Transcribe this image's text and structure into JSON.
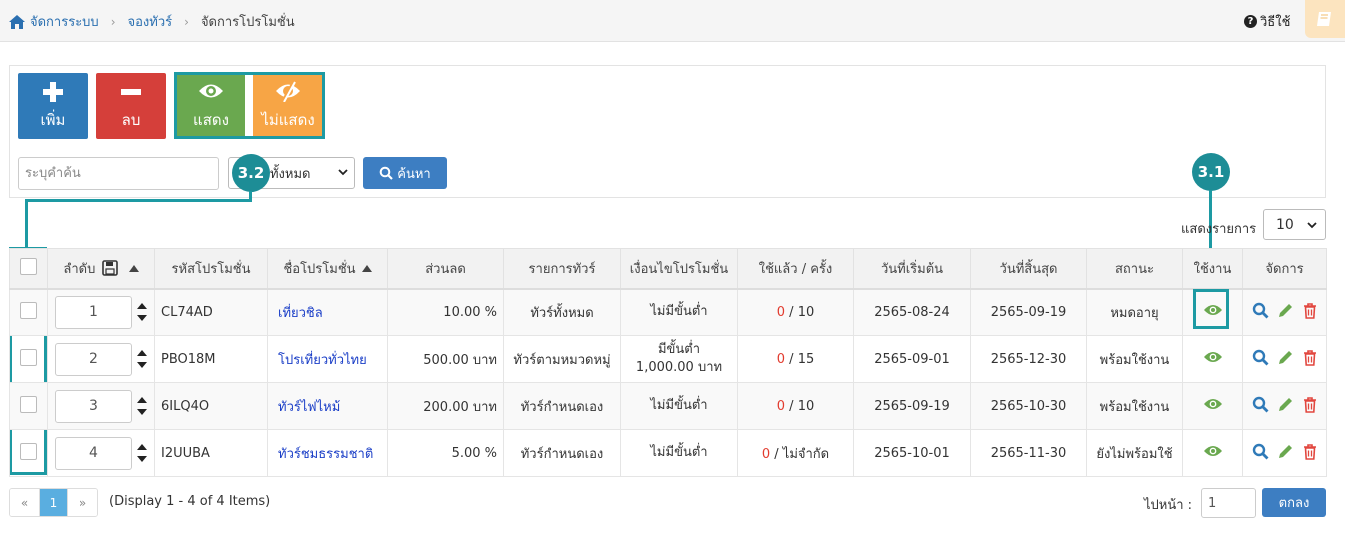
{
  "breadcrumb": {
    "home": "จัดการระบบ",
    "section": "จองทัวร์",
    "current": "จัดการโปรโมชั่น"
  },
  "help": {
    "label": "วิธีใช้"
  },
  "toolbar": {
    "add": "เพิ่ม",
    "delete": "ลบ",
    "show": "แสดง",
    "hide": "ไม่แสดง"
  },
  "search": {
    "placeholder": "ระบุคำค้น",
    "filter_value": "ะทั้งหมด",
    "button": "ค้นหา"
  },
  "callouts": {
    "a": "3.2",
    "b": "3.1"
  },
  "perpage": {
    "label": "แสดงรายการ",
    "value": "10"
  },
  "table": {
    "headers": [
      "ลำดับ",
      "รหัสโปรโมชั่น",
      "ชื่อโปรโมชั่น",
      "ส่วนลด",
      "รายการทัวร์",
      "เงื่อนไขโปรโมชั่น",
      "ใช้แล้ว / ครั้ง",
      "วันที่เริ่มต้น",
      "วันที่สิ้นสุด",
      "สถานะ",
      "ใช้งาน",
      "จัดการ"
    ],
    "rows": [
      {
        "order": "1",
        "code": "CL74AD",
        "name": "เที่ยวชิล",
        "discount": "10.00 %",
        "tours": "ทัวร์ทั้งหมด",
        "condition": "ไม่มีขั้นต่ำ",
        "used": "0",
        "limit": " / 10",
        "start": "2565-08-24",
        "end": "2565-09-19",
        "status": "หมดอายุ"
      },
      {
        "order": "2",
        "code": "PBO18M",
        "name": "โปรเที่ยวทั่วไทย",
        "discount": "500.00 บาท",
        "tours": "ทัวร์ตามหมวดหมู่",
        "condition": "มีขั้นต่ำ 1,000.00 บาท",
        "used": "0",
        "limit": " / 15",
        "start": "2565-09-01",
        "end": "2565-12-30",
        "status": "พร้อมใช้งาน"
      },
      {
        "order": "3",
        "code": "6ILQ4O",
        "name": "ทัวร์ไฟไหม้",
        "discount": "200.00 บาท",
        "tours": "ทัวร์กำหนดเอง",
        "condition": "ไม่มีขั้นต่ำ",
        "used": "0",
        "limit": " / 10",
        "start": "2565-09-19",
        "end": "2565-10-30",
        "status": "พร้อมใช้งาน"
      },
      {
        "order": "4",
        "code": "I2UUBA",
        "name": "ทัวร์ชมธรรมชาติ",
        "discount": "5.00 %",
        "tours": "ทัวร์กำหนดเอง",
        "condition": "ไม่มีขั้นต่ำ",
        "used": "0",
        "limit": " / ไม่จำกัด",
        "start": "2565-10-01",
        "end": "2565-11-30",
        "status": "ยังไม่พร้อมใช้"
      }
    ]
  },
  "pagination": {
    "prev": "«",
    "page": "1",
    "next": "»",
    "display": "(Display 1 - 4 of 4 Items)",
    "goto_label": "ไปหน้า :",
    "goto_value": "1",
    "ok": "ตกลง"
  },
  "colors": {
    "accent": "#1d9aa3",
    "primary": "#3d7ec2",
    "add": "#2f7ab8",
    "delete": "#d53f3a",
    "show": "#6aa84f",
    "hide": "#f7a545"
  }
}
